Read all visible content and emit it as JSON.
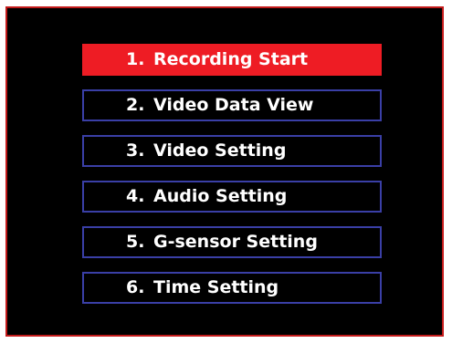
{
  "menu": {
    "selected_index": 0,
    "items": [
      {
        "number": "1.",
        "label": "Recording Start"
      },
      {
        "number": "2.",
        "label": "Video Data View"
      },
      {
        "number": "3.",
        "label": "Video Setting"
      },
      {
        "number": "4.",
        "label": "Audio Setting"
      },
      {
        "number": "5.",
        "label": "G-sensor Setting"
      },
      {
        "number": "6.",
        "label": "Time Setting"
      }
    ]
  },
  "colors": {
    "screen_background": "#000000",
    "screen_border": "#c21a1a",
    "item_border": "#3a3fa6",
    "selected_background": "#ee1c24",
    "text": "#ffffff"
  }
}
